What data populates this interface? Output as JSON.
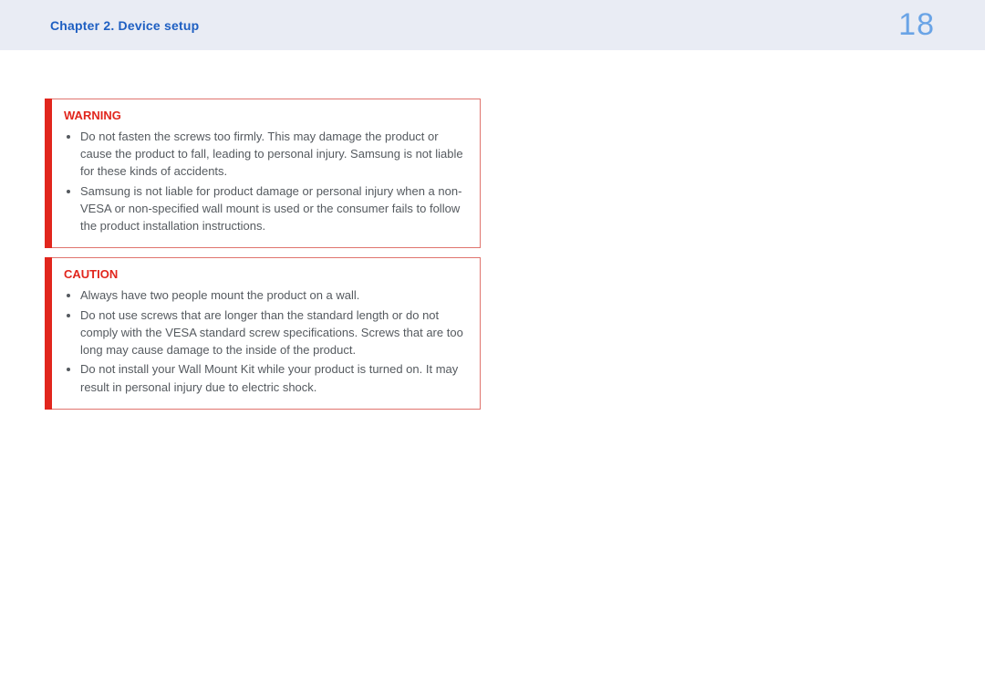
{
  "header": {
    "chapter_title": "Chapter 2. Device setup",
    "page_number": "18"
  },
  "warning_box": {
    "title": "WARNING",
    "items": [
      "Do not fasten the screws too firmly. This may damage the product or cause the product to fall, leading to personal injury. Samsung is not liable for these kinds of accidents.",
      "Samsung is not liable for product damage or personal injury when a non-VESA or non-specified wall mount is used or the consumer fails to follow the product installation instructions."
    ]
  },
  "caution_box": {
    "title": "CAUTION",
    "items": [
      "Always have two people mount the product on a wall.",
      "Do not use screws that are longer than the standard length or do not comply with the VESA standard screw specifications. Screws that are too long may cause damage to the inside of the product.",
      "Do not install your Wall Mount Kit while your product is turned on. It may result in personal injury due to electric shock."
    ]
  }
}
